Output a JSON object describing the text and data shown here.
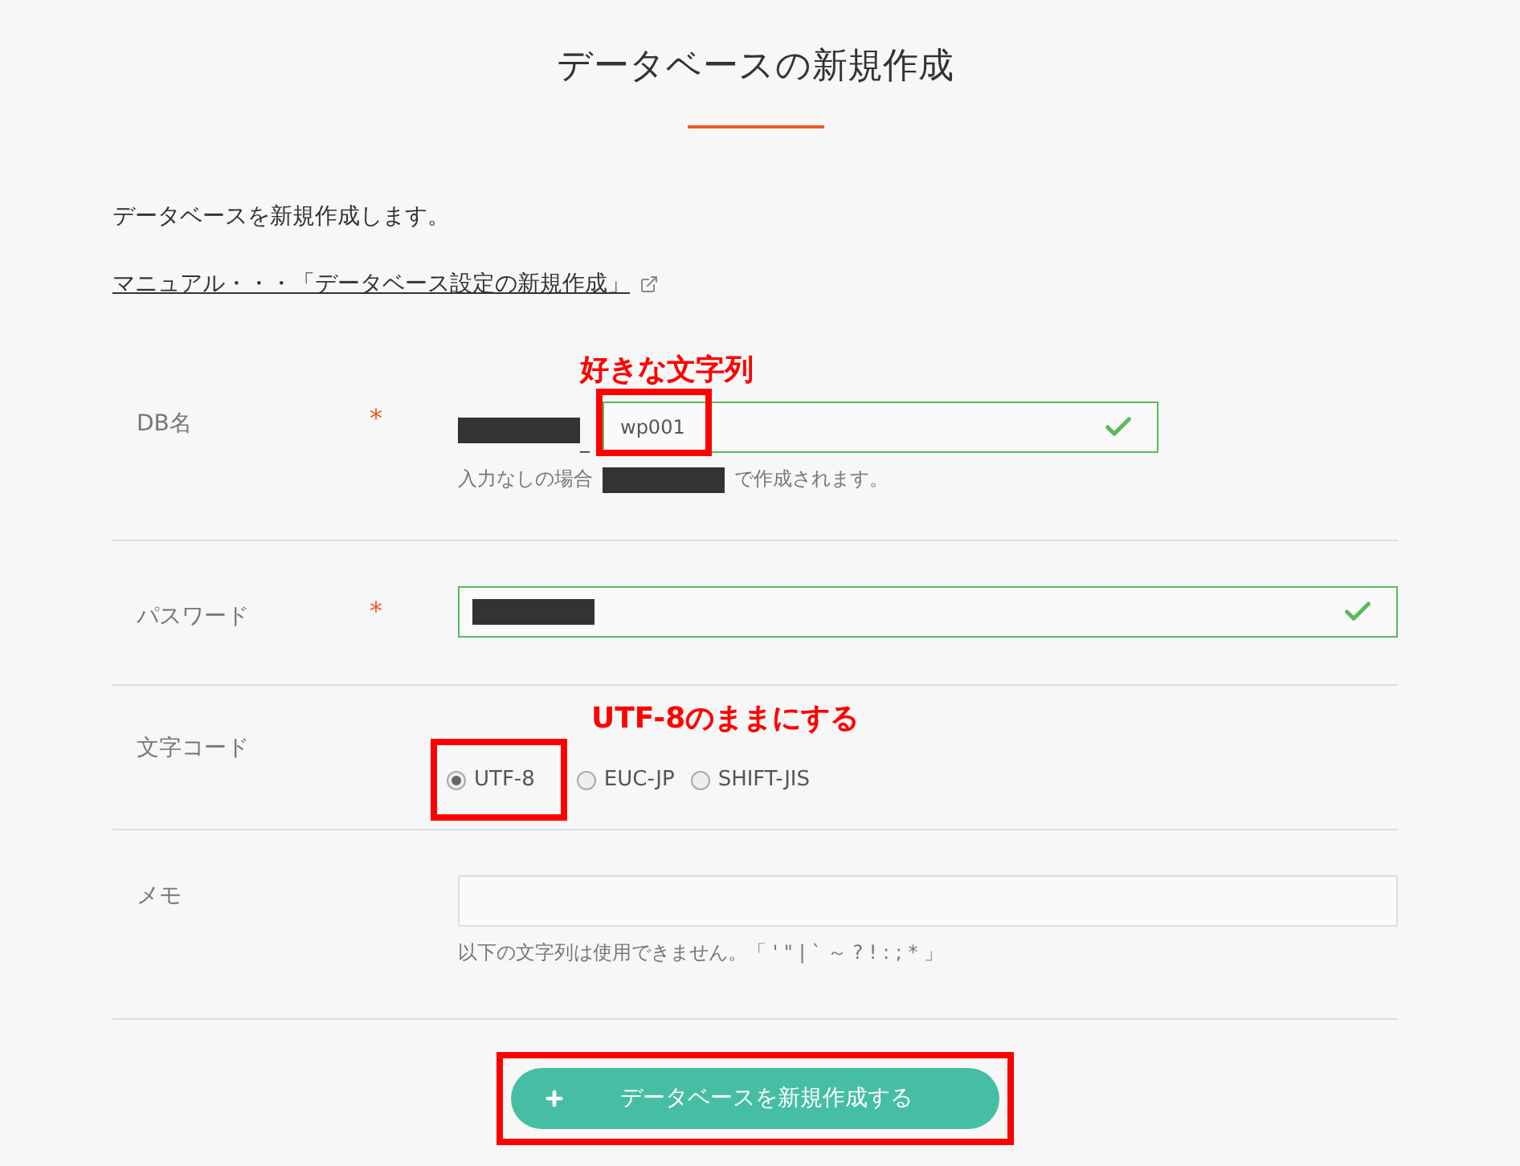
{
  "title": "データベースの新規作成",
  "intro": "データベースを新規作成します。",
  "manual_link": "マニュアル・・・「データベース設定の新規作成」",
  "fields": [
    {
      "kind": "text",
      "label": "DB名",
      "required_mark": "*",
      "separator": "_",
      "value": "wp001",
      "valid": true,
      "hint_before": "入力なしの場合",
      "hint_after": "で作成されます。",
      "annotation": "好きな文字列"
    },
    {
      "kind": "password",
      "label": "パスワード",
      "required_mark": "*",
      "valid": true
    },
    {
      "kind": "radio",
      "label": "文字コード",
      "annotation": "UTF-8のままにする",
      "options": [
        {
          "label": "UTF-8",
          "selected": true
        },
        {
          "label": "EUC-JP",
          "selected": false
        },
        {
          "label": "SHIFT-JIS",
          "selected": false
        }
      ]
    },
    {
      "kind": "textarea",
      "label": "メモ",
      "hint": "以下の文字列は使用できません。「 ' \" | ` ～ ? ! : ; * 」"
    }
  ],
  "submit": {
    "label": "データベースを新規作成する"
  }
}
